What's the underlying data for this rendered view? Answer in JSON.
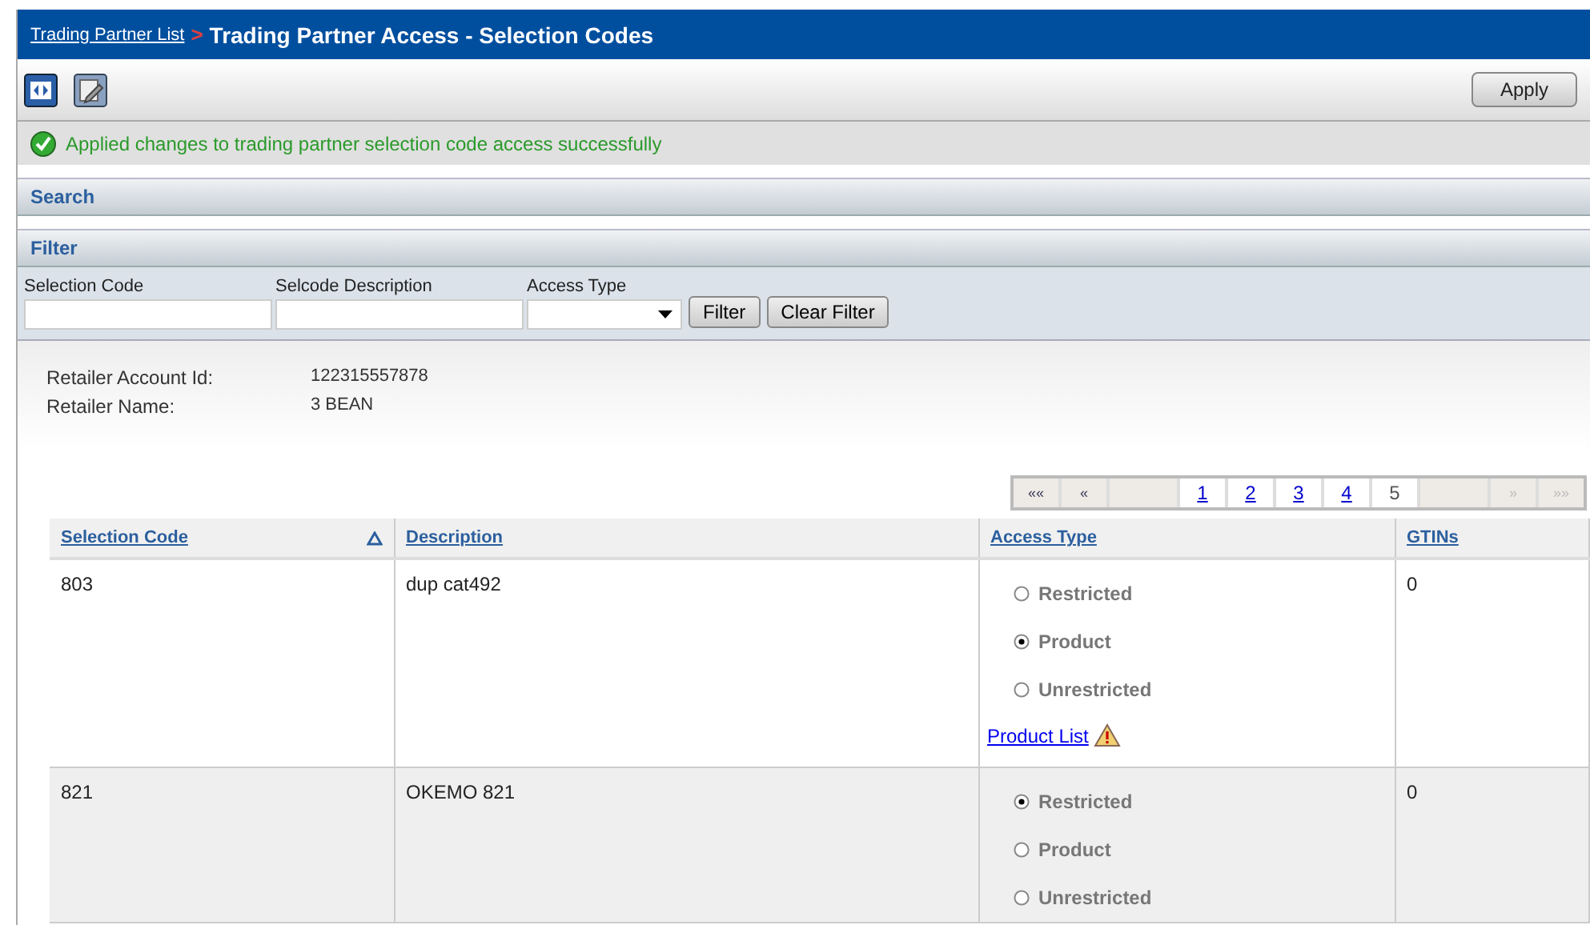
{
  "breadcrumb": {
    "link": "Trading Partner List",
    "separator": ">",
    "title": "Trading Partner Access - Selection Codes"
  },
  "toolbar": {
    "apply_label": "Apply"
  },
  "message": {
    "text": "Applied changes to trading partner selection code access successfully"
  },
  "sections": [
    "Search",
    "Filter"
  ],
  "filter": {
    "fields": [
      {
        "label": "Selection Code",
        "kind": "text"
      },
      {
        "label": "Selcode Description",
        "kind": "text"
      },
      {
        "label": "Access Type",
        "kind": "select"
      }
    ],
    "buttons": [
      "Filter",
      "Clear Filter"
    ]
  },
  "retailer": [
    {
      "label": "Retailer Account Id:",
      "value": "122315557878"
    },
    {
      "label": "Retailer Name:",
      "value": "3 BEAN"
    }
  ],
  "pager": [
    {
      "label": "««",
      "kind": "nav",
      "disabled": false
    },
    {
      "label": "«",
      "kind": "nav",
      "disabled": false
    },
    {
      "kind": "spacer"
    },
    {
      "label": "1",
      "kind": "page",
      "selected": false
    },
    {
      "label": "2",
      "kind": "page",
      "selected": false
    },
    {
      "label": "3",
      "kind": "page",
      "selected": false
    },
    {
      "label": "4",
      "kind": "page",
      "selected": false
    },
    {
      "label": "5",
      "kind": "page",
      "selected": true
    },
    {
      "kind": "spacer"
    },
    {
      "label": "»",
      "kind": "nav",
      "disabled": true
    },
    {
      "label": "»»",
      "kind": "nav",
      "disabled": true
    }
  ],
  "table": {
    "columns": [
      {
        "label": "Selection Code",
        "sorted": true
      },
      {
        "label": "Description",
        "sorted": false
      },
      {
        "label": "Access Type",
        "sorted": false
      },
      {
        "label": "GTINs",
        "sorted": false
      }
    ],
    "rows": [
      {
        "code": "803",
        "description": "dup cat492",
        "options": [
          {
            "label": "Restricted",
            "selected": false
          },
          {
            "label": "Product",
            "selected": true
          },
          {
            "label": "Unrestricted",
            "selected": false
          }
        ],
        "link": "Product List",
        "warning": true,
        "gtins": "0"
      },
      {
        "code": "821",
        "description": "OKEMO 821",
        "options": [
          {
            "label": "Restricted",
            "selected": true
          },
          {
            "label": "Product",
            "selected": false
          },
          {
            "label": "Unrestricted",
            "selected": false
          }
        ],
        "gtins": "0"
      }
    ]
  }
}
